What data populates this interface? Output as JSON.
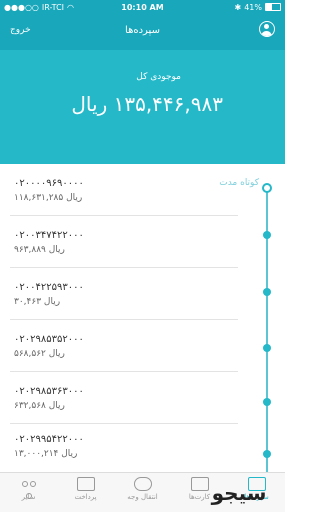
{
  "status_bar": {
    "carrier": "IR-TCI",
    "time": "10:10 AM",
    "battery": "41%"
  },
  "nav": {
    "title": "سپرده‌ها",
    "logout_label": "خروج"
  },
  "balance": {
    "label": "موجودی کل",
    "value": "۱۳۵,۴۴۶,۹۸۳ ریال"
  },
  "section_label": "کوتاه مدت",
  "accounts": [
    {
      "number": "۰۲۰۰۰۰۹۶۹۰۰۰۰",
      "balance": "۱۱۸,۶۳۱,۲۸۵ ریال"
    },
    {
      "number": "۰۲۰۰۳۴۷۴۲۲۰۰۰",
      "balance": "۹۶۳,۸۸۹ ریال"
    },
    {
      "number": "۰۲۰۰۴۲۲۵۹۳۰۰۰",
      "balance": "۳۰,۴۶۳ ریال"
    },
    {
      "number": "۰۲۰۲۹۸۵۳۵۲۰۰۰",
      "balance": "۵۶۸,۵۶۲ ریال"
    },
    {
      "number": "۰۲۰۲۹۸۵۳۶۳۰۰۰",
      "balance": "۶۳۲,۵۶۸ ریال"
    },
    {
      "number": "۰۲۰۲۹۹۵۴۲۲۰۰۰",
      "balance": "۱۳,۰۰۰,۲۱۴ ریال"
    }
  ],
  "tabs": [
    {
      "label": "سایر",
      "icon": "more-icon"
    },
    {
      "label": "پرداخت",
      "icon": "wallet-icon"
    },
    {
      "label": "انتقال وجه",
      "icon": "transfer-icon"
    },
    {
      "label": "کارت‌ها",
      "icon": "cards-icon"
    },
    {
      "label": "سپرده‌ها",
      "icon": "deposit-icon"
    }
  ],
  "watermark": "سیجو",
  "colors": {
    "primary": "#19a7bb",
    "header": "#24b8c9"
  }
}
